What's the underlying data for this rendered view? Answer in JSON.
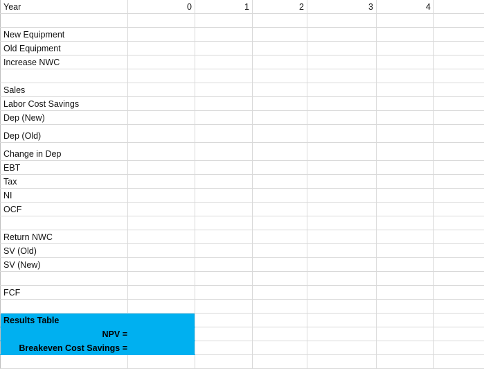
{
  "sheet": {
    "header_row": {
      "label": "Year",
      "years": [
        "0",
        "1",
        "2",
        "3",
        "4"
      ]
    },
    "row_labels": {
      "new_equipment": "New Equipment",
      "old_equipment": "Old Equipment",
      "increase_nwc": "Increase NWC",
      "sales": "Sales",
      "labor_cost_savings": "Labor Cost Savings",
      "dep_new": "Dep (New)",
      "dep_old": "Dep (Old)",
      "change_in_dep": "Change in Dep",
      "ebt": "EBT",
      "tax": "Tax",
      "ni": "NI",
      "ocf": "OCF",
      "return_nwc": "Return NWC",
      "sv_old": "SV (Old)",
      "sv_new": "SV (New)",
      "fcf": "FCF"
    },
    "results": {
      "title": "Results Table",
      "npv_label": "NPV =",
      "breakeven_label": "Breakeven Cost Savings =",
      "fill_color": "#00b0f0"
    }
  }
}
